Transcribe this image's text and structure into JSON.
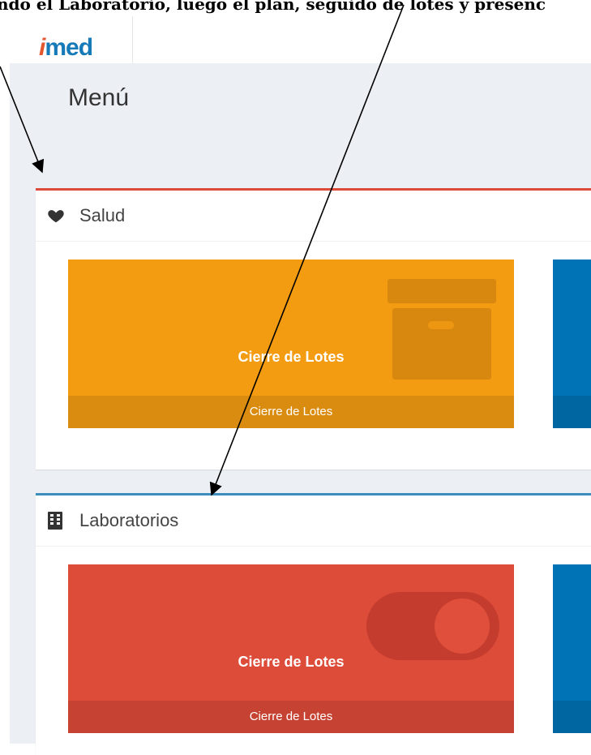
{
  "annotation": {
    "text": "ndo el Laboratorio, luego el plan, seguido de lotes y presenc"
  },
  "brand": {
    "logo_i": "i",
    "logo_rest": "med",
    "primary_color": "#1679b8",
    "accent_color": "#e2572f"
  },
  "page": {
    "title": "Menú"
  },
  "sections": [
    {
      "title": "Salud",
      "icon": "heart-icon",
      "border_color": "#dd4b39",
      "tile": {
        "label": "Cierre de Lotes",
        "footer": "Cierre de Lotes",
        "icon": "archive-box-icon",
        "bg_color": "#f39c12",
        "footer_color": "#da8c10"
      },
      "side_tile_color": "#0073b7"
    },
    {
      "title": "Laboratorios",
      "icon": "building-icon",
      "border_color": "#3c8dbc",
      "tile": {
        "label": "Cierre de Lotes",
        "footer": "Cierre de Lotes",
        "icon": "toggle-switch-icon",
        "bg_color": "#dd4b39",
        "footer_color": "#c64333"
      },
      "side_tile_color": "#0073b7"
    }
  ]
}
